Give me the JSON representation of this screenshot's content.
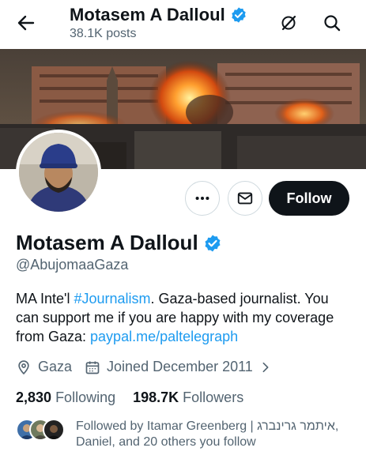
{
  "header": {
    "name": "Motasem A Dalloul",
    "posts": "38.1K posts"
  },
  "icons": {
    "back": "back-arrow-icon",
    "verified": "verified-badge-icon",
    "grok": "grok-icon",
    "search": "search-icon",
    "more": "more-dots-icon",
    "message": "envelope-icon",
    "location": "location-pin-icon",
    "calendar": "calendar-icon",
    "chevron": "chevron-right-icon"
  },
  "actions": {
    "follow_label": "Follow"
  },
  "profile": {
    "name": "Motasem A Dalloul",
    "handle": "@AbujomaaGaza",
    "bio_part1": "MA Inte'l ",
    "bio_hashtag": "#Journalism",
    "bio_part2": ". Gaza-based journalist. You can support me if you are happy with my coverage from Gaza: ",
    "bio_link": "paypal.me/paltelegraph",
    "location": "Gaza",
    "joined": "Joined December 2011"
  },
  "stats": {
    "following_count": "2,830",
    "following_label": "Following",
    "followers_count": "198.7K",
    "followers_label": "Followers"
  },
  "followed_by": {
    "text": "Followed by Itamar Greenberg | איתמר גרינברג, Daniel, and 20 others you follow"
  },
  "colors": {
    "accent": "#1d9bf0",
    "text": "#0f1419",
    "secondary": "#536471",
    "follow_button": "#0f1419"
  }
}
